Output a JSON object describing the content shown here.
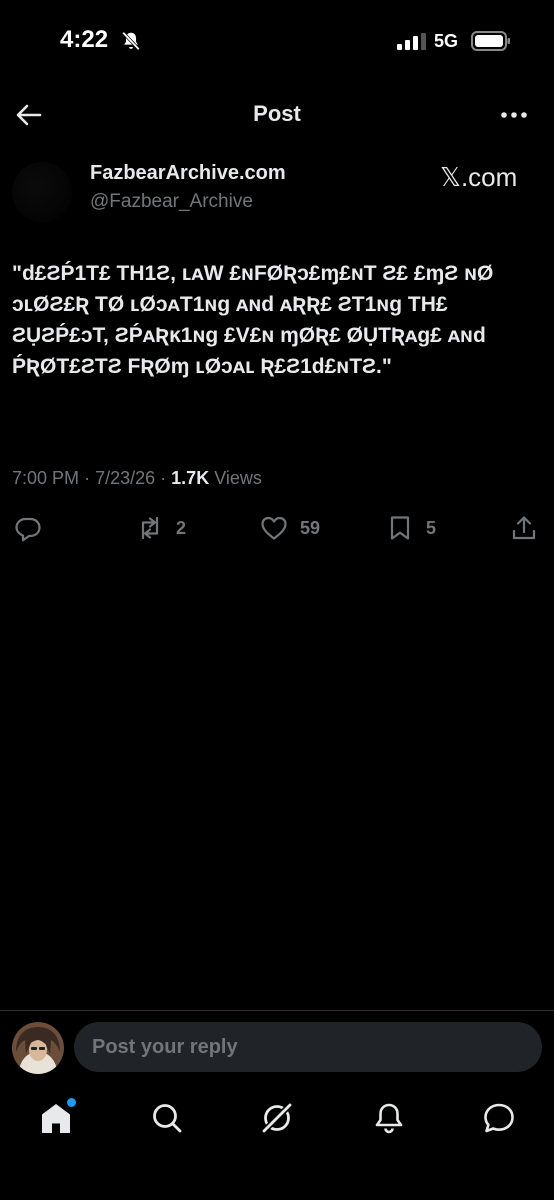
{
  "status_bar": {
    "time": "4:22",
    "network": "5G"
  },
  "header": {
    "title": "Post"
  },
  "author": {
    "name": "FazbearArchive.com",
    "handle": "@Fazbear_Archive",
    "source": "𝕏.com"
  },
  "post": {
    "text": "\"d£ƧṔ1T£ TH1Ƨ, ʟᴀW £ɴFØƦɔ£ɱ£ɴT Ƨ£ £ɱƧ ɴØ ɔʟØƧ£Ʀ TØ ʟØɔᴀT1ɴɡ ᴀɴd ᴀƦƦ£ ƧT1ɴɡ TH£ ƧỤƧṔ£ɔT, ƧṔᴀƦĸ1ɴɡ £V£ɴ ɱØƦ£ ØỤTƦᴀɡ£ ᴀɴd ṔƦØT£ƧTƧ FƦØɱ ʟØɔᴀʟ Ʀ£Ƨ1d£ɴTƧ.\"",
    "time": "7:00 PM",
    "date": "7/23/26",
    "views_count": "1.7K",
    "views_label": "Views",
    "sep": "·"
  },
  "actions": {
    "reposts": "2",
    "likes": "59",
    "bookmarks": "5"
  },
  "reply": {
    "placeholder": "Post your reply"
  },
  "colors": {
    "background": "#000000",
    "text": "#e7e9ea",
    "muted": "#71767b",
    "accent": "#1d9bf0",
    "input_bg": "#202327"
  },
  "icons": {
    "status": [
      "bell-slash-icon",
      "signal-icon",
      "battery-icon"
    ],
    "header": [
      "back-arrow-icon",
      "more-icon"
    ],
    "actions": [
      "reply-icon",
      "repost-icon",
      "like-icon",
      "bookmark-icon",
      "share-icon"
    ],
    "nav": [
      "home-icon",
      "search-icon",
      "grok-icon",
      "notifications-icon",
      "messages-icon"
    ]
  }
}
